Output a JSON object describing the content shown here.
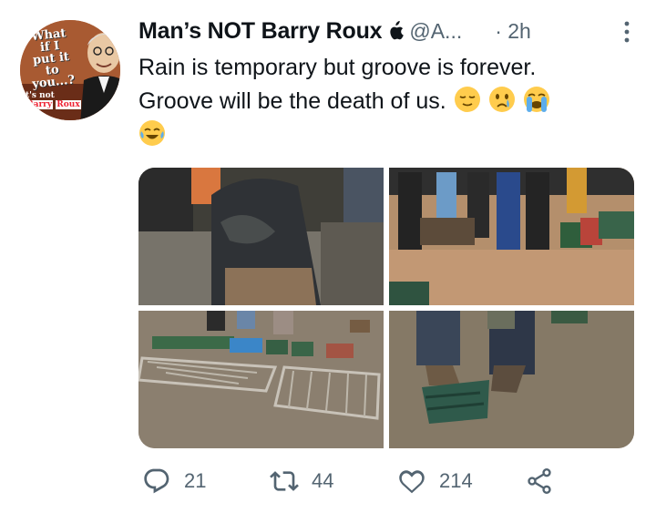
{
  "author": {
    "name": "Man’s NOT Barry Roux",
    "handle": "@A...",
    "time": "· 2h",
    "avatar_text": [
      "What",
      "if I",
      "put it",
      "to you...?"
    ],
    "avatar_footer": [
      "t's not",
      "Barry",
      "Roux"
    ]
  },
  "tweet": {
    "line1": "Rain is temporary but groove is forever.",
    "line2": "Groove will be the death of us."
  },
  "icons": {
    "verified_badge": "apple-icon",
    "more": "more-vertical-icon",
    "emojis": [
      "relieved-face-emoji",
      "crying-face-emoji",
      "loudly-crying-face-emoji",
      "tears-of-joy-emoji"
    ]
  },
  "actions": {
    "replies": "21",
    "retweets": "44",
    "likes": "214"
  },
  "colors": {
    "text": "#0f1419",
    "secondary": "#536471",
    "background": "#ffffff"
  }
}
